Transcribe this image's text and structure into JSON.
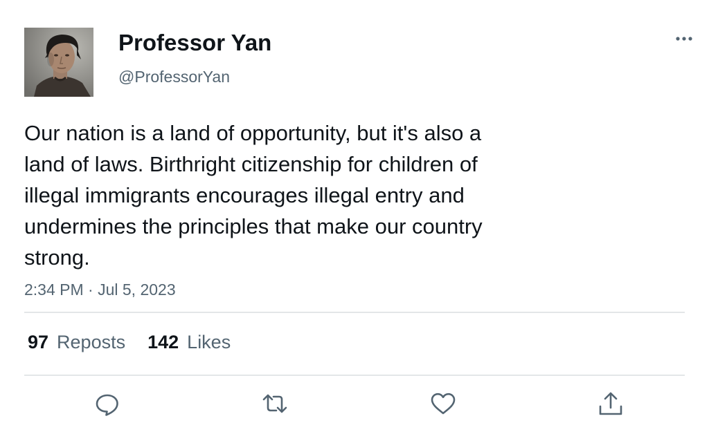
{
  "author": {
    "display_name": "Professor Yan",
    "handle": "@ProfessorYan",
    "avatar_icon": "profile-photo"
  },
  "tweet": {
    "text": "Our nation is a land of opportunity, but it's also a\nland of laws. Birthright citizenship for children of\nillegal immigrants encourages illegal entry and\nundermines the principles that make our country\nstrong.",
    "timestamp": "2:34 PM · Jul 5, 2023"
  },
  "stats": {
    "reposts_count": "97",
    "reposts_label": "Reposts",
    "likes_count": "142",
    "likes_label": "Likes"
  },
  "actions": [
    {
      "name": "reply",
      "icon": "speech-bubble-icon"
    },
    {
      "name": "repost",
      "icon": "repost-arrows-icon"
    },
    {
      "name": "like",
      "icon": "heart-icon"
    },
    {
      "name": "share",
      "icon": "share-upload-icon"
    }
  ],
  "menu": {
    "icon": "more-dots-icon"
  },
  "colors": {
    "text_primary": "#0f1419",
    "text_secondary": "#536471",
    "divider": "#e3e6e8",
    "icon": "#536471"
  }
}
